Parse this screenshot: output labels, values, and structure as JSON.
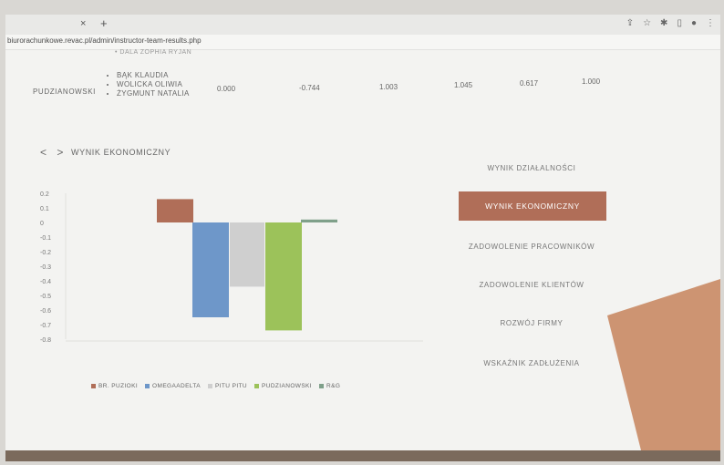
{
  "browser": {
    "tab_close": "×",
    "tab_new": "+",
    "url": "biurorachunkowe.revac.pl/admin/instructor-team-results.php"
  },
  "table_row": {
    "cut_text": "• DALA ZOPHIA RYJAN",
    "team": "PUDZIANOWSKI",
    "members": [
      "BĄK KLAUDIA",
      "WOLICKA OLIWIA",
      "ŻYGMUNT NATALIA"
    ],
    "values": [
      "0.000",
      "-0.744",
      "1.003",
      "1.045",
      "0.617",
      "1.000"
    ]
  },
  "section": {
    "nav_arrows": "< >",
    "title": "WYNIK EKONOMICZNY"
  },
  "menu": {
    "items": [
      "WYNIK DZIAŁALNOŚCI",
      "WYNIK EKONOMICZNY",
      "ZADOWOLENIE PRACOWNIKÓW",
      "ZADOWOLENIE KLIENTÓW",
      "ROZWÓJ FIRMY",
      "WSKAŹNIK ZADŁUŻENIA"
    ],
    "active_index": 1
  },
  "chart_data": {
    "type": "bar",
    "title": "",
    "xlabel": "",
    "ylabel": "",
    "ylim": [
      -0.8,
      0.2
    ],
    "yticks": [
      "0.2",
      "0.1",
      "0",
      "-0.1",
      "-0.2",
      "-0.3",
      "-0.4",
      "-0.5",
      "-0.6",
      "-0.7",
      "-0.8"
    ],
    "series": [
      {
        "name": "BR. PUZIOKI",
        "value": 0.16,
        "color": "#b06e58"
      },
      {
        "name": "OMEGAADELTA",
        "value": -0.65,
        "color": "#6e97c9"
      },
      {
        "name": "PITU PITU",
        "value": -0.44,
        "color": "#cfcfcf"
      },
      {
        "name": "PUDZIANOWSKI",
        "value": -0.74,
        "color": "#9cc25a"
      },
      {
        "name": "R&G",
        "value": 0.02,
        "color": "#7fa08a"
      }
    ]
  }
}
